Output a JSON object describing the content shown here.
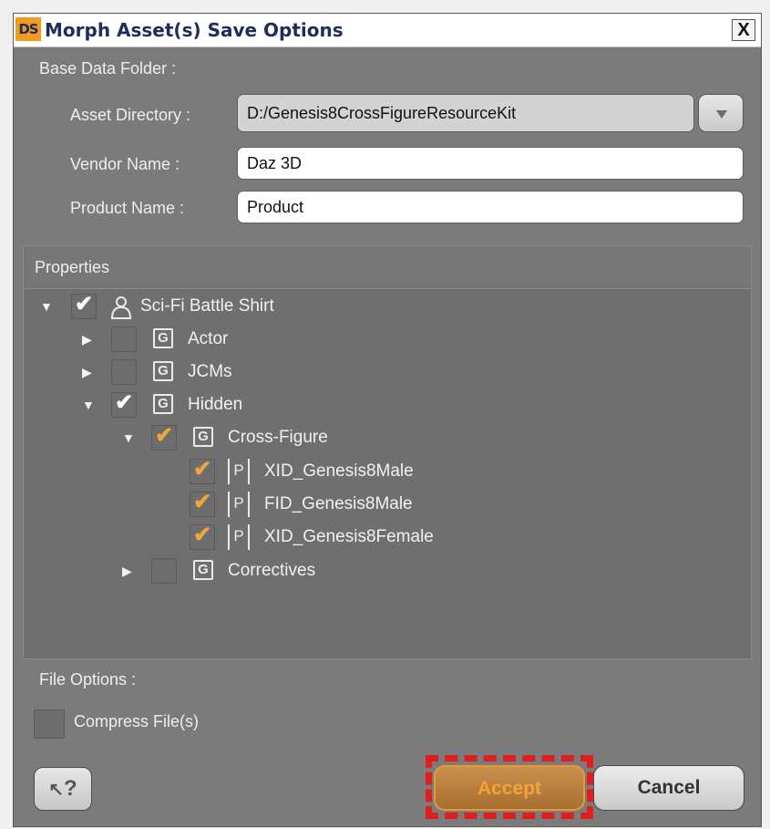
{
  "window": {
    "title": "Morph Asset(s) Save Options",
    "logo": "DS",
    "close_label": "X"
  },
  "base_data_folder": {
    "heading": "Base Data Folder :",
    "asset_directory_label": "Asset Directory :",
    "asset_directory_value": "D:/Genesis8CrossFigureResourceKit",
    "vendor_name_label": "Vendor Name :",
    "vendor_name_value": "Daz 3D",
    "product_name_label": "Product Name :",
    "product_name_value": "Product"
  },
  "properties": {
    "heading": "Properties",
    "items": [
      {
        "label": "Sci-Fi Battle Shirt",
        "icon": "figure-icon",
        "checked": true,
        "expanded": true
      },
      {
        "label": "Actor",
        "icon": "G",
        "checked": false,
        "expanded": false
      },
      {
        "label": "JCMs",
        "icon": "G",
        "checked": false,
        "expanded": false
      },
      {
        "label": "Hidden",
        "icon": "G",
        "checked": true,
        "expanded": true
      },
      {
        "label": "Cross-Figure",
        "icon": "G",
        "checked": true,
        "expanded": true,
        "check_color": "#f0a43a"
      },
      {
        "label": "XID_Genesis8Male",
        "icon": "P",
        "checked": true,
        "check_color": "#f0a43a"
      },
      {
        "label": "FID_Genesis8Male",
        "icon": "P",
        "checked": true,
        "check_color": "#f0a43a"
      },
      {
        "label": "XID_Genesis8Female",
        "icon": "P",
        "checked": true,
        "check_color": "#f0a43a"
      },
      {
        "label": "Correctives",
        "icon": "G",
        "checked": false,
        "expanded": false
      }
    ]
  },
  "file_options": {
    "heading": "File Options :",
    "compress_label": "Compress File(s)",
    "compress_checked": false
  },
  "buttons": {
    "help": "?",
    "accept": "Accept",
    "cancel": "Cancel"
  },
  "colors": {
    "window_bg": "#7b7b7b",
    "title_text": "#1d2d5c",
    "accent_orange": "#f0a43a",
    "highlight_red": "#e01e1e"
  }
}
